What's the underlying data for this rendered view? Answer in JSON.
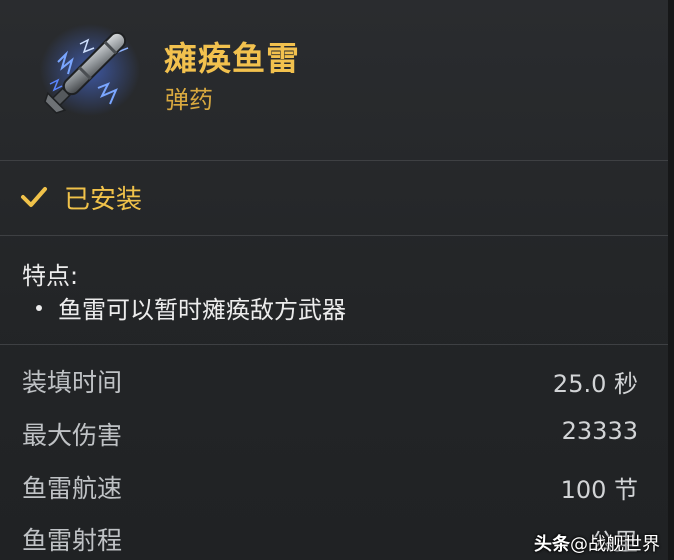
{
  "item": {
    "name": "瘫痪鱼雷",
    "type": "弹药",
    "icon": "electric-torpedo-icon"
  },
  "status": {
    "icon": "check-icon",
    "label": "已安装"
  },
  "features": {
    "title": "特点:",
    "items": [
      "鱼雷可以暂时瘫痪敌方武器"
    ]
  },
  "stats": [
    {
      "label": "装填时间",
      "value": "25.0 秒"
    },
    {
      "label": "最大伤害",
      "value": "23333"
    },
    {
      "label": "鱼雷航速",
      "value": "100 节"
    },
    {
      "label": "鱼雷射程",
      "value": "公里"
    }
  ],
  "watermark": {
    "logo": "头条",
    "text": "@战舰世界"
  },
  "colors": {
    "title": "#f2c14e",
    "accent": "#f0c24a",
    "background": "#232527"
  }
}
